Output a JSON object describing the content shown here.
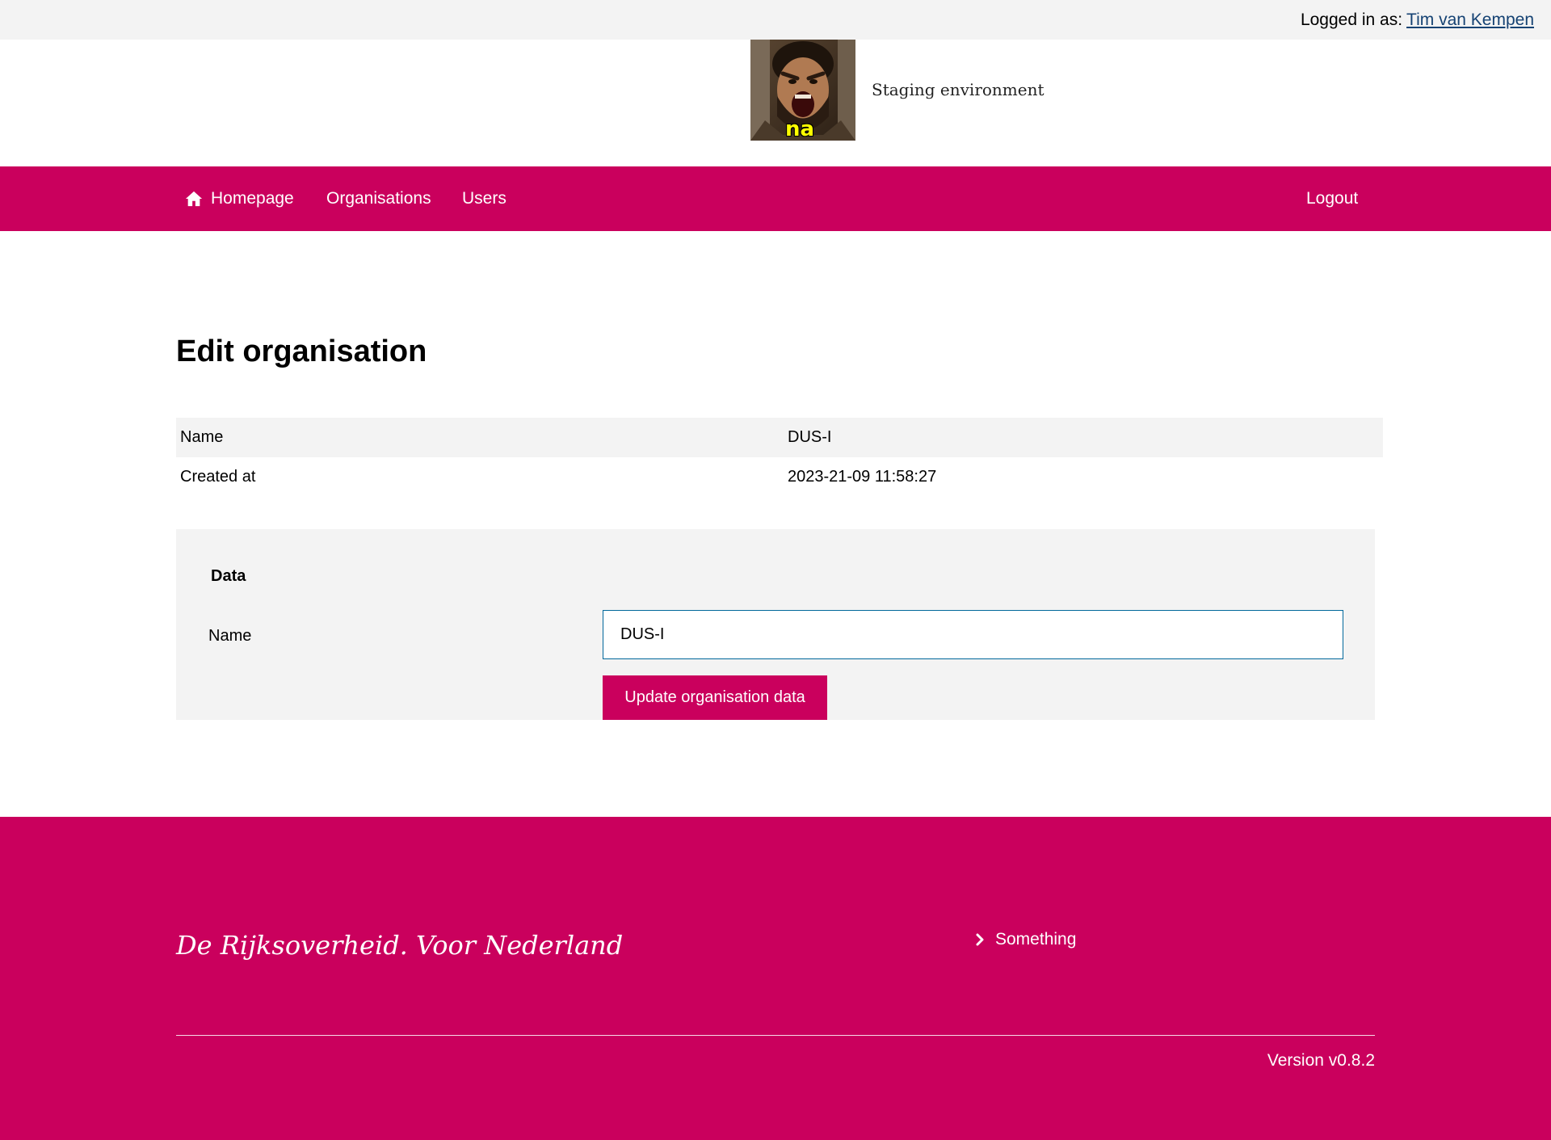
{
  "topbar": {
    "logged_in_label": "Logged in as:",
    "user_name": "Tim van Kempen"
  },
  "header": {
    "logo_caption": "na",
    "environment": "Staging environment"
  },
  "nav": {
    "items": [
      {
        "label": "Homepage",
        "icon": "home-icon"
      },
      {
        "label": "Organisations"
      },
      {
        "label": "Users"
      }
    ],
    "logout": "Logout"
  },
  "page": {
    "title": "Edit organisation"
  },
  "details": {
    "rows": [
      {
        "key": "Name",
        "value": "DUS-I"
      },
      {
        "key": "Created at",
        "value": "2023-21-09 11:58:27"
      }
    ]
  },
  "form": {
    "section_title": "Data",
    "name_label": "Name",
    "name_value": "DUS-I",
    "submit_label": "Update organisation data"
  },
  "footer": {
    "tagline": "De Rijksoverheid. Voor Nederland",
    "link_label": "Something",
    "version": "Version v0.8.2"
  },
  "colors": {
    "brand": "#ca005d",
    "link": "#154273",
    "input_border": "#01689b",
    "panel_bg": "#f3f3f3"
  }
}
